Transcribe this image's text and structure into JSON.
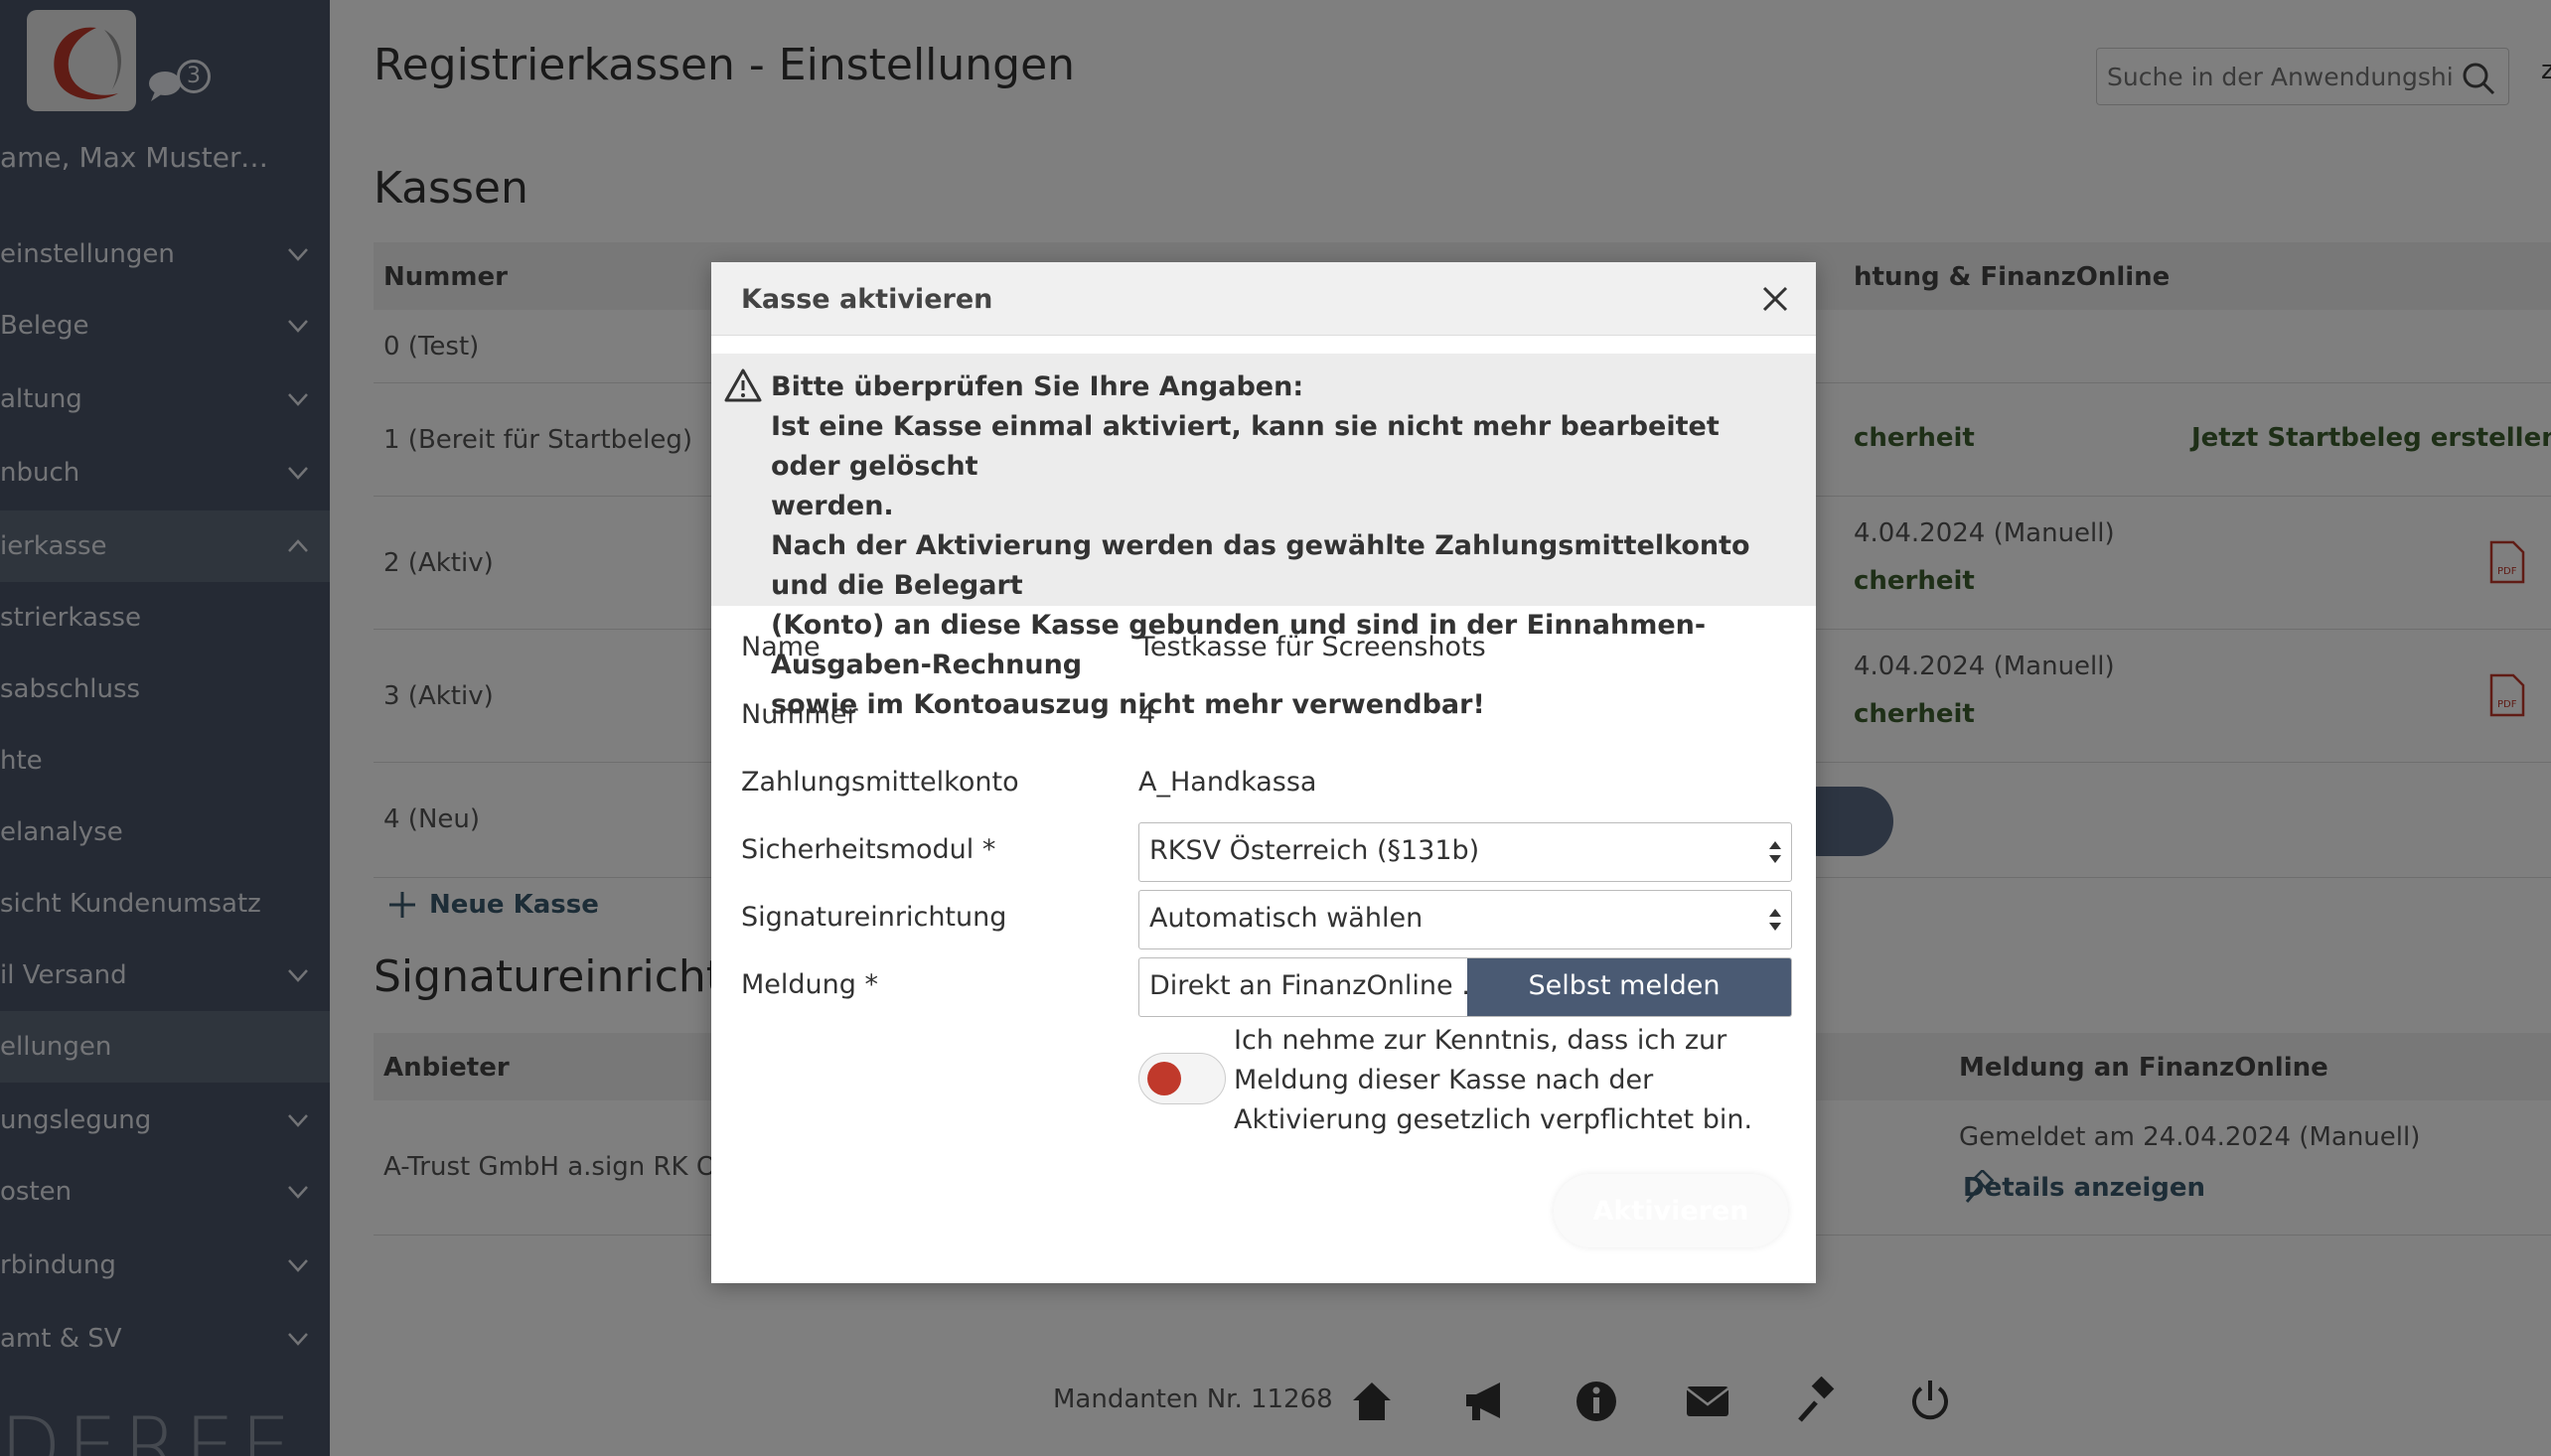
{
  "sidebar": {
    "user_name": "ame, Max Musterman…",
    "chat_count": "3",
    "items": [
      {
        "label": "einstellungen",
        "chevron": "down"
      },
      {
        "label": "Belege",
        "chevron": "down"
      },
      {
        "label": "altung",
        "chevron": "down"
      },
      {
        "label": "nbuch",
        "chevron": "down"
      },
      {
        "label": "ierkasse",
        "chevron": "up"
      },
      {
        "label": "strierkasse",
        "chevron": ""
      },
      {
        "label": "sabschluss",
        "chevron": ""
      },
      {
        "label": "hte",
        "chevron": ""
      },
      {
        "label": "elanalyse",
        "chevron": ""
      },
      {
        "label": "sicht Kundenumsatz",
        "chevron": ""
      },
      {
        "label": "il Versand",
        "chevron": "down"
      },
      {
        "label": "ellungen",
        "chevron": ""
      },
      {
        "label": "ungslegung",
        "chevron": "down"
      },
      {
        "label": "osten",
        "chevron": "down"
      },
      {
        "label": "rbindung",
        "chevron": "down"
      },
      {
        "label": "amt & SV",
        "chevron": "down"
      }
    ],
    "brand": "DEREE"
  },
  "header": {
    "title": "Registrierkassen - Einstellungen",
    "search_placeholder": "Suche in der Anwendungshilfe",
    "cut_text": "z"
  },
  "kassen": {
    "title": "Kassen",
    "columns": [
      "Nummer",
      "htung & FinanzOnline"
    ],
    "rows": [
      {
        "nummer": "0 (Test)",
        "info1": "",
        "info2": "",
        "action": ""
      },
      {
        "nummer": "1 (Bereit für Startbeleg)",
        "info1": "cherheit",
        "info2": "",
        "action": "Jetzt Startbeleg erstellen"
      },
      {
        "nummer": "2 (Aktiv)",
        "info1": "4.04.2024 (Manuell)",
        "info2": "cherheit",
        "action": ""
      },
      {
        "nummer": "3 (Aktiv)",
        "info1": "4.04.2024 (Manuell)",
        "info2": "cherheit",
        "action": ""
      },
      {
        "nummer": "4 (Neu)",
        "info1": "",
        "info2": "",
        "action": ""
      }
    ],
    "new_label": "Neue Kasse"
  },
  "signatur": {
    "title": "Signatureinrichtun",
    "columns": [
      "Anbieter",
      "Meldung an FinanzOnline"
    ],
    "row": {
      "anbieter": "A-Trust GmbH a.sign RK ONL",
      "meldung": "Gemeldet am 24.04.2024 (Manuell)",
      "details": "Details anzeigen"
    }
  },
  "footer": {
    "mandant": "Mandanten Nr. 11268"
  },
  "dialog": {
    "title": "Kasse aktivieren",
    "warning": [
      "Bitte überprüfen Sie Ihre Angaben:",
      "Ist eine Kasse einmal aktiviert, kann sie nicht mehr bearbeitet oder gelöscht",
      "werden.",
      "Nach der Aktivierung werden das gewählte Zahlungsmittelkonto und die Belegart",
      "(Konto) an diese Kasse gebunden und sind in der Einnahmen-Ausgaben-Rechnung",
      "sowie im Kontoauszug nicht mehr verwendbar!"
    ],
    "fields": {
      "name_label": "Name",
      "name_value": "Testkasse für Screenshots",
      "nummer_label": "Nummer",
      "nummer_value": "4",
      "konto_label": "Zahlungsmittelkonto",
      "konto_value": "A_Handkassa",
      "modul_label": "Sicherheitsmodul *",
      "modul_value": "RKSV Österreich (§131b)",
      "signatur_label": "Signatureinrichtung",
      "signatur_value": "Automatisch wählen",
      "meldung_label": "Meldung *",
      "meldung_opt1": "Direkt an FinanzOnline …",
      "meldung_opt2": "Selbst melden"
    },
    "ack_text": "Ich nehme zur Kenntnis, dass ich zur Meldung dieser Kasse nach der Aktivierung gesetzlich verpflichtet bin.",
    "activate_label": "Aktivieren"
  }
}
